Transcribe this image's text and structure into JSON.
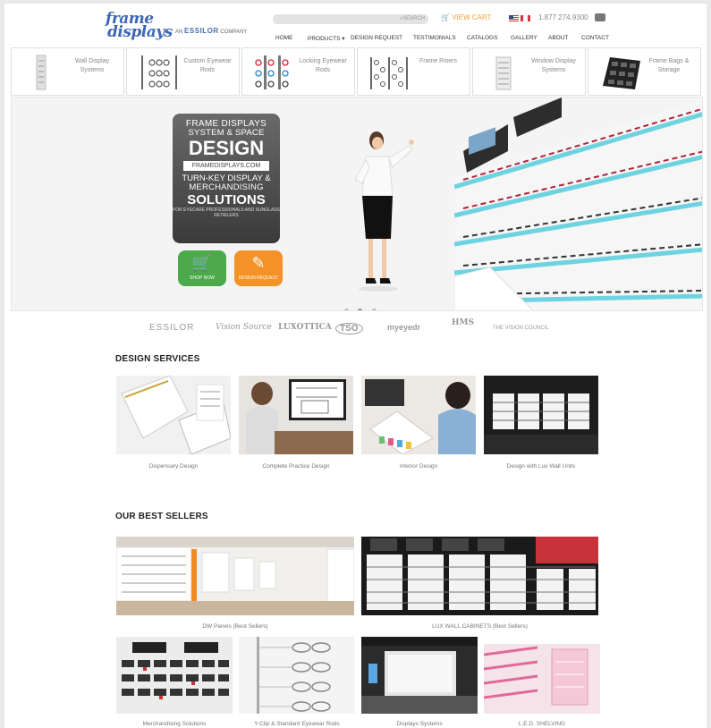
{
  "header": {
    "logo_line1": "frame",
    "logo_line2": "displays",
    "logo_sub_prefix": "AN",
    "logo_sub_brand": "ESSILOR",
    "logo_sub_suffix": "COMPANY",
    "search_button": "SEARCH",
    "cart_label": "VIEW CART",
    "phone": "1.877.274.9300"
  },
  "nav": {
    "items": [
      "HOME",
      "PRODUCTS ▾",
      "DESIGN REQUEST",
      "TESTIMONIALS",
      "CATALOGS",
      "GALLERY",
      "ABOUT",
      "CONTACT"
    ]
  },
  "categories": [
    {
      "label": "Wall Display Systems",
      "icon": "wall-display-icon"
    },
    {
      "label": "Custom Eyewear Rods",
      "icon": "eyewear-rods-icon"
    },
    {
      "label": "Locking Eyewear Rods",
      "icon": "locking-rods-icon"
    },
    {
      "label": "Frame Risers",
      "icon": "frame-risers-icon"
    },
    {
      "label": "Window Display Systems",
      "icon": "window-display-icon"
    },
    {
      "label": "Frame Bags & Storage",
      "icon": "frame-bags-icon"
    }
  ],
  "hero": {
    "line1": "FRAME DISPLAYS",
    "line2": "SYSTEM & SPACE",
    "line3": "DESIGN",
    "site": "FRAMEDISPLAYS.COM",
    "line4": "TURN-KEY DISPLAY &",
    "line5": "MERCHANDISING",
    "line6": "SOLUTIONS",
    "line7": "FOR EYECARE PROFESSIONALS AND SUNGLASS RETAILERS",
    "shop_now": "SHOP NOW",
    "design_request": "DESIGN REQUEST",
    "slide_active": 1,
    "slide_count": 3
  },
  "partners": [
    "ESSILOR",
    "Vision Source",
    "LUXOTTICA",
    "TSO",
    "myeyedr",
    "HMS",
    "THE VISION COUNCIL"
  ],
  "design_services": {
    "title": "DESIGN SERVICES",
    "items": [
      "Dispensary Design",
      "Complete Practice Design",
      "Interior Design",
      "Design with Lux Wall Units"
    ]
  },
  "best_sellers": {
    "title": "OUR BEST SELLERS",
    "items": [
      "DW Panels (Best Sellers)",
      "LUX WALL CABINETS (Best Sellers)",
      "Merchandising Solutions",
      "Y-Clip & Standard Eyewear Rods",
      "Displays Systems",
      "L.E.D. SHELVING"
    ]
  },
  "colors": {
    "brand_blue": "#3d67b4",
    "cart_orange": "#f2a03c",
    "shop_green": "#4caa4b",
    "design_orange": "#f29227",
    "wall_teal": "#6ed3e0"
  }
}
